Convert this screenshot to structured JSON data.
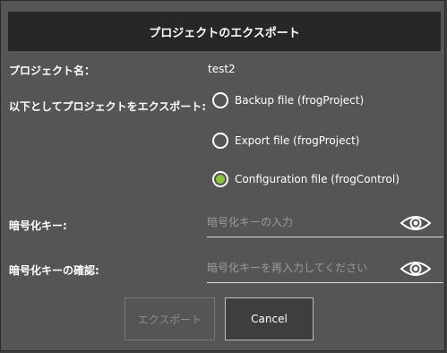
{
  "dialog": {
    "title": "プロジェクトのエクスポート",
    "project_name_label": "プロジェクト名：",
    "project_name_value": "test2",
    "export_as_label": "以下としてプロジェクトをエクスポート:",
    "options": [
      {
        "label": "Backup file (frogProject)",
        "selected": false
      },
      {
        "label": "Export file (frogProject)",
        "selected": false
      },
      {
        "label": "Configuration file (frogControl)",
        "selected": true
      }
    ],
    "key_label": "暗号化キー:",
    "key_placeholder": "暗号化キーの入力",
    "confirm_label": "暗号化キーの確認:",
    "confirm_placeholder": "暗号化キーを再入力してください",
    "export_button": "エクスポート",
    "cancel_button": "Cancel",
    "accent_color": "#8cc63f"
  }
}
